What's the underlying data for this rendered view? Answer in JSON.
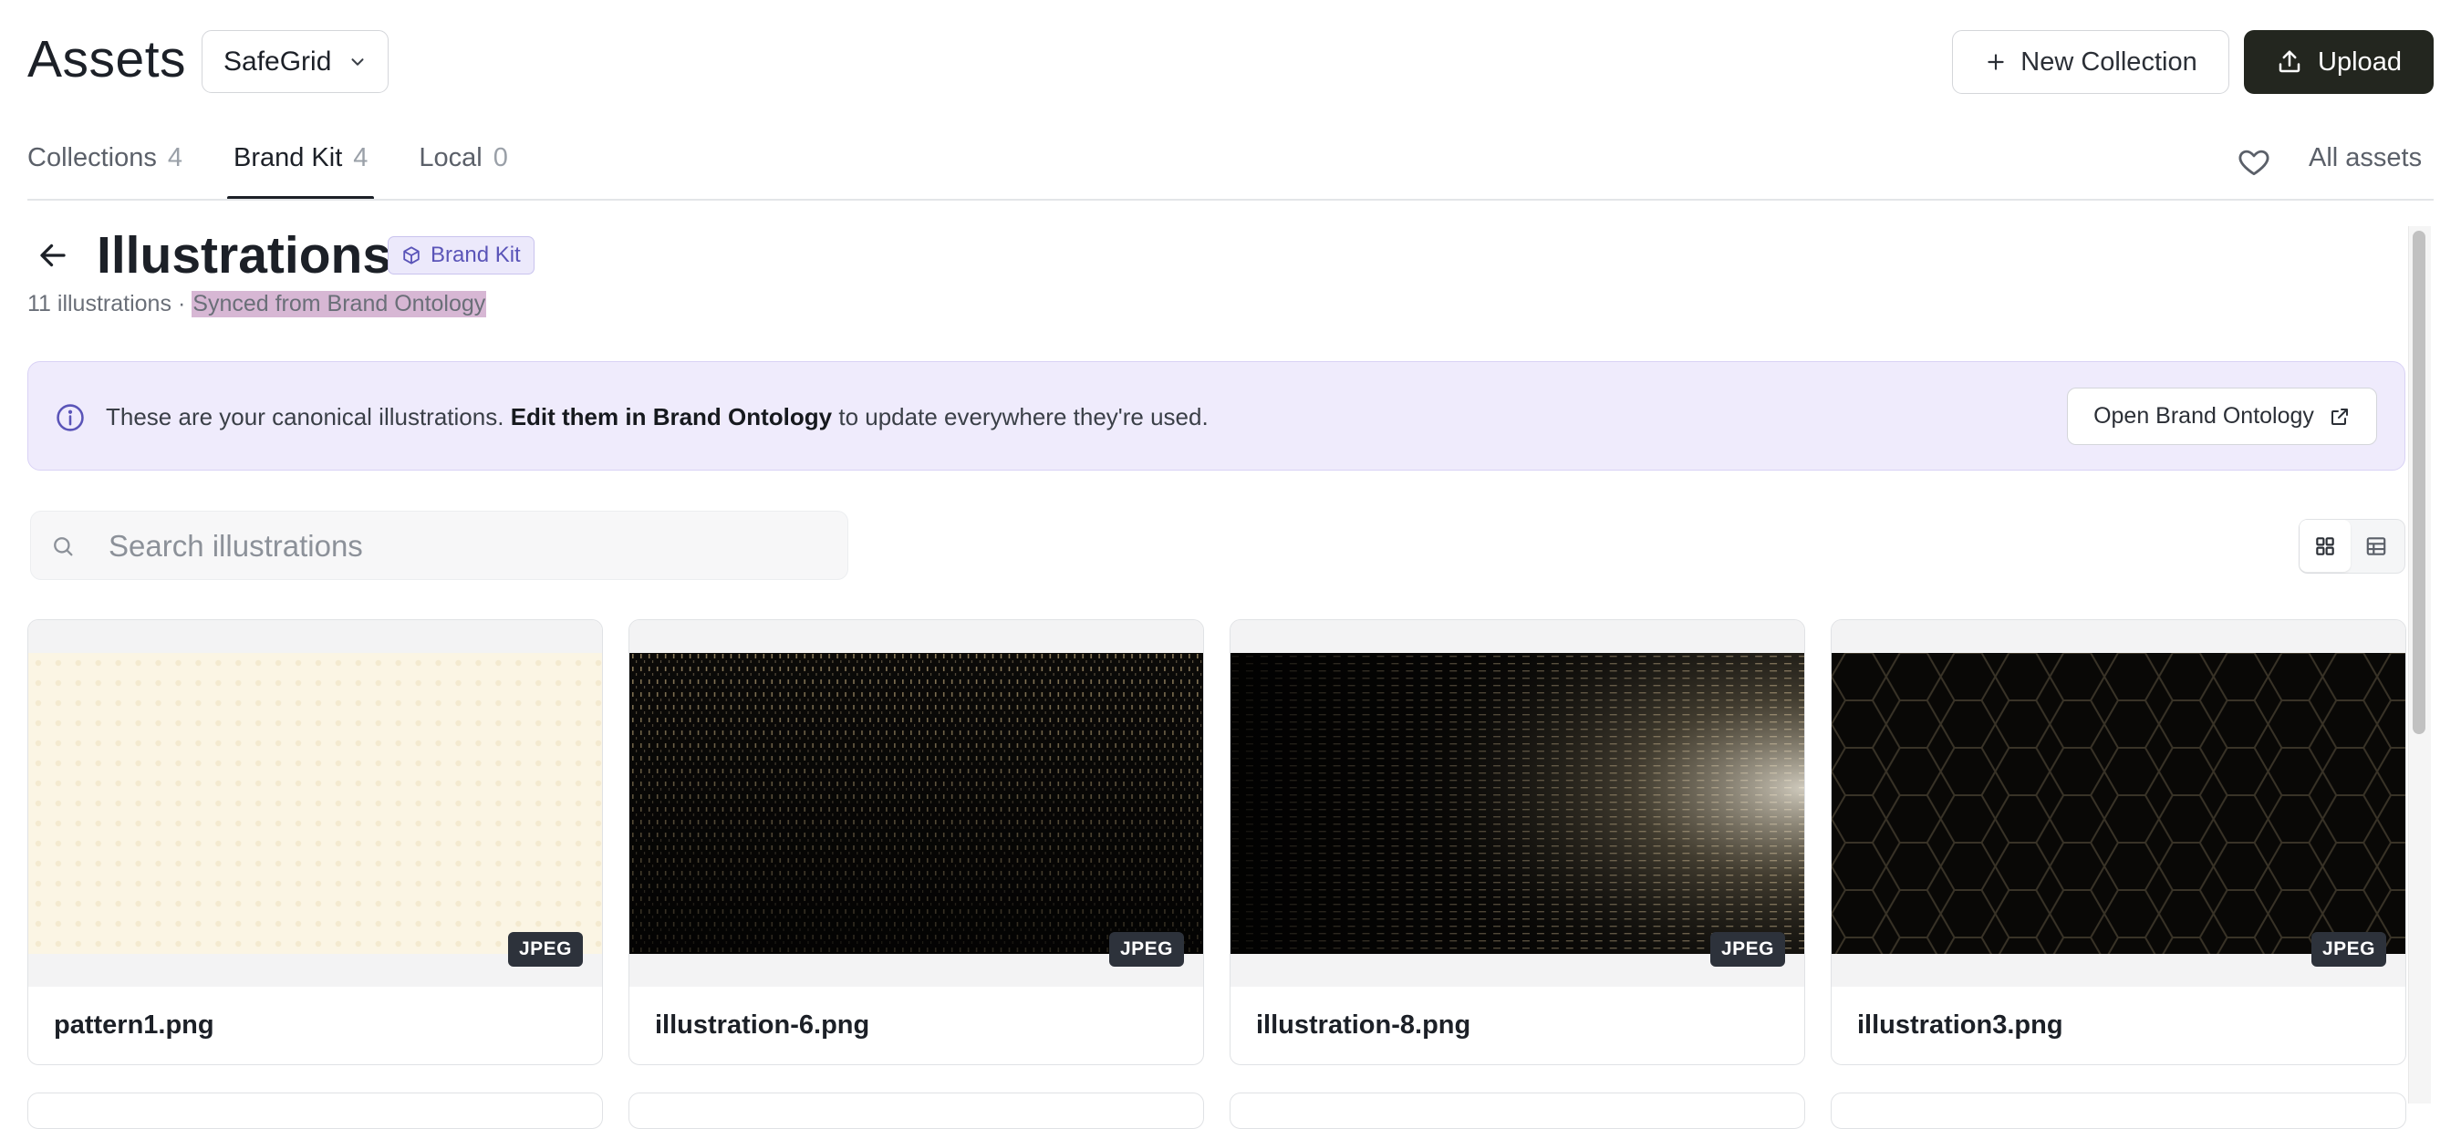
{
  "header": {
    "title": "Assets",
    "workspace": "SafeGrid",
    "new_collection_label": "New Collection",
    "upload_label": "Upload"
  },
  "tabs": [
    {
      "label": "Collections",
      "count": "4"
    },
    {
      "label": "Brand Kit",
      "count": "4",
      "active": true
    },
    {
      "label": "Local",
      "count": "0"
    }
  ],
  "all_assets_label": "All assets",
  "section": {
    "title": "Illustrations",
    "badge": "Brand Kit",
    "count_text": "11 illustrations",
    "separator": "·",
    "sync_text": "Synced from Brand Ontology"
  },
  "banner": {
    "text_before": "These are your canonical illustrations.",
    "text_bold": "Edit them in Brand Ontology",
    "text_after": "to update everywhere they're used.",
    "button_label": "Open Brand Ontology"
  },
  "search": {
    "placeholder": "Search illustrations",
    "value": ""
  },
  "cards": [
    {
      "name": "pattern1.png",
      "format": "JPEG",
      "thumb": "cream-dot-pattern"
    },
    {
      "name": "illustration-6.png",
      "format": "JPEG",
      "thumb": "dark-vertical-particles"
    },
    {
      "name": "illustration-8.png",
      "format": "JPEG",
      "thumb": "dark-horizontal-particles"
    },
    {
      "name": "illustration3.png",
      "format": "JPEG",
      "thumb": "dark-hexagon-grid"
    }
  ],
  "colors": {
    "primary_dark": "#23261f",
    "banner_bg": "#efebfc",
    "badge_text": "#5a54b8",
    "highlight": "#d7b7d4"
  }
}
